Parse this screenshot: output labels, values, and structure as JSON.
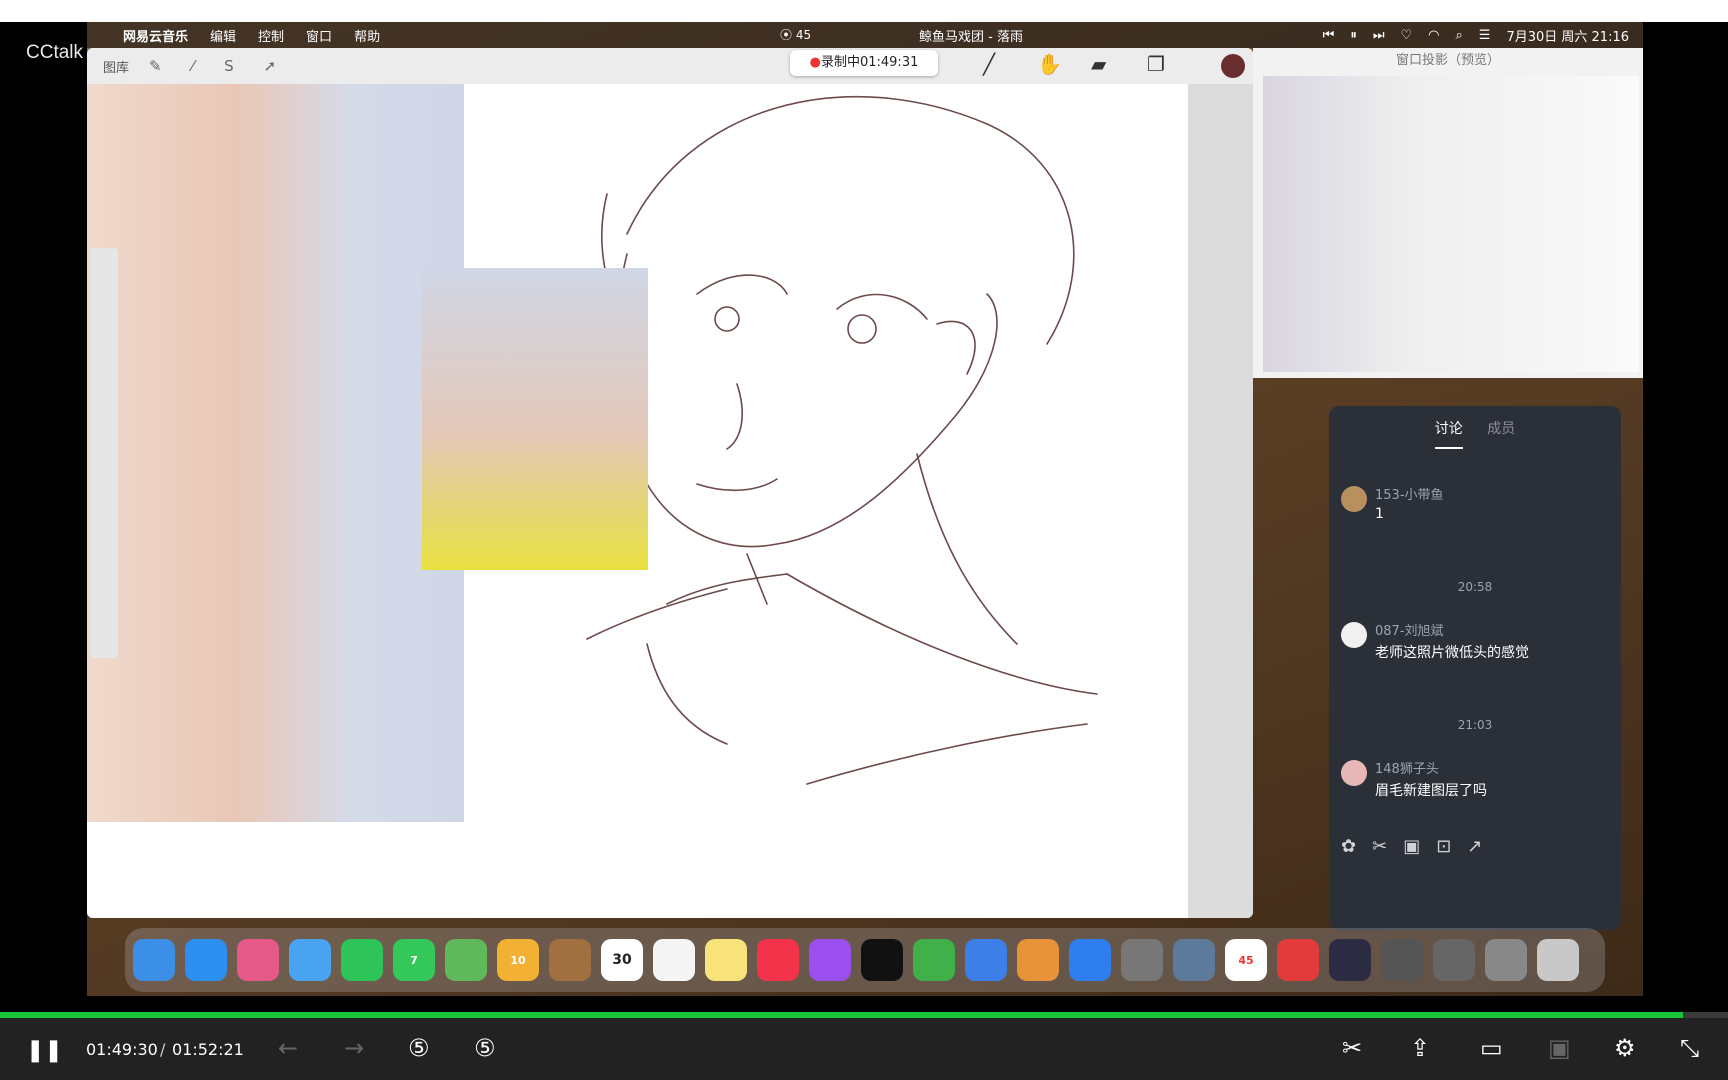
{
  "overlay": {
    "app_label": "CCtalk"
  },
  "menubar": {
    "items": [
      "网易云音乐",
      "编辑",
      "控制",
      "窗口",
      "帮助"
    ],
    "recording_count": "45",
    "now_playing": "鲸鱼马戏团 - 落雨",
    "datetime": "7月30日 周六 21:16"
  },
  "procreate": {
    "gallery_label": "图库",
    "recording_badge": "录制中01:49:31",
    "tools": [
      "brush-icon",
      "smudge-icon",
      "eraser-icon",
      "layers-icon"
    ]
  },
  "preview": {
    "title": "窗口投影（预览）"
  },
  "chat": {
    "tabs": [
      "讨论",
      "成员"
    ],
    "messages": [
      {
        "name": "153-小带鱼",
        "text": "1"
      },
      {
        "name": "087-刘旭斌",
        "text": "老师这照片微低头的感觉"
      },
      {
        "name": "148狮子头",
        "text": "眉毛新建图层了吗"
      }
    ],
    "timestamps": [
      "20:58",
      "21:03"
    ]
  },
  "dock": {
    "calendar_day": "30",
    "badges": [
      "7",
      "10",
      "45"
    ]
  },
  "player": {
    "current_time": "01:49:30",
    "separator": "/",
    "total_time": "01:52:21",
    "progress": 0.974
  },
  "colors": {
    "progress": "#19c43a",
    "chat_bg": "#2b2f38",
    "player_bg": "#222222"
  }
}
